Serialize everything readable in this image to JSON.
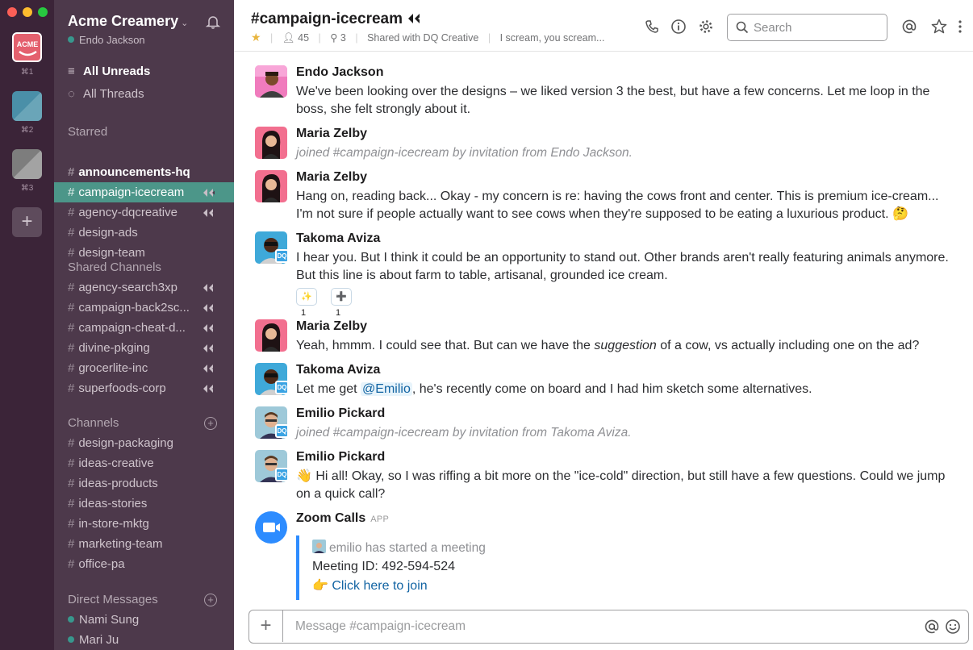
{
  "workspace": {
    "name": "Acme Creamery",
    "user": "Endo Jackson",
    "tiles": [
      {
        "label": "ACME",
        "shortcut": "⌘1",
        "color": "#e4606e"
      },
      {
        "label": "",
        "shortcut": "⌘2",
        "color": "#4a8fa8"
      },
      {
        "label": "",
        "shortcut": "⌘3",
        "color": "#888888"
      }
    ]
  },
  "sidebar": {
    "all_unreads": "All Unreads",
    "all_threads": "All Threads",
    "starred_heading": "Starred",
    "starred": [
      {
        "name": "announcements-hq",
        "bold": true,
        "shared": false,
        "active": false
      },
      {
        "name": "campaign-icecream",
        "bold": false,
        "shared": true,
        "active": true
      },
      {
        "name": "agency-dqcreative",
        "bold": false,
        "shared": true,
        "active": false
      },
      {
        "name": "design-ads",
        "bold": false,
        "shared": false,
        "active": false
      },
      {
        "name": "design-team",
        "bold": false,
        "shared": false,
        "active": false
      }
    ],
    "shared_heading": "Shared Channels",
    "shared_channels": [
      {
        "name": "agency-search3xp"
      },
      {
        "name": "campaign-back2sc..."
      },
      {
        "name": "campaign-cheat-d..."
      },
      {
        "name": "divine-pkging"
      },
      {
        "name": "grocerlite-inc"
      },
      {
        "name": "superfoods-corp"
      }
    ],
    "channels_heading": "Channels",
    "channels": [
      {
        "name": "design-packaging"
      },
      {
        "name": "ideas-creative"
      },
      {
        "name": "ideas-products"
      },
      {
        "name": "ideas-stories"
      },
      {
        "name": "in-store-mktg"
      },
      {
        "name": "marketing-team"
      },
      {
        "name": "office-pa"
      }
    ],
    "dm_heading": "Direct Messages",
    "direct_messages": [
      {
        "name": "Nami Sung"
      },
      {
        "name": "Mari Ju"
      }
    ]
  },
  "header": {
    "channel": "#campaign-icecream",
    "members": "45",
    "pinned": "3",
    "shared_with": "Shared with DQ Creative",
    "topic": "I scream, you scream..."
  },
  "search": {
    "placeholder": "Search"
  },
  "messages": [
    {
      "author": "Endo Jackson",
      "text": "We've been looking over the designs – we liked version 3 the best, but have a few concerns. Let me loop in the boss, she felt strongly about it."
    },
    {
      "author": "Maria Zelby",
      "text": "joined #campaign-icecream by invitation from Endo Jackson."
    },
    {
      "author": "Maria Zelby",
      "text": "Hang on, reading back... Okay - my concern is re: having the cows front and center. This is premium ice-cream... I'm not sure if people actually want to see cows when they're supposed to be eating a luxurious product.",
      "emoji": "🤔"
    },
    {
      "author": "Takoma Aviza",
      "badge": "DQ",
      "text": "I hear you. But I think it could be an opportunity to stand out. Other brands aren't really featuring animals anymore. But this line is about farm to table, artisanal, grounded ice cream.",
      "reactions": [
        {
          "emoji": "✨",
          "count": "1"
        },
        {
          "emoji": "➕",
          "count": "1"
        }
      ]
    },
    {
      "author": "Maria Zelby",
      "text_before": "Yeah, hmmm. I could see that. But can we have the ",
      "text_em": "suggestion",
      "text_after": " of a cow, vs actually including one on the ad?"
    },
    {
      "author": "Takoma Aviza",
      "badge": "DQ",
      "text_before": "Let me get ",
      "mention": "@Emilio",
      "text_after": ", he's recently come on board and I had him sketch some alternatives."
    },
    {
      "author": "Emilio Pickard",
      "badge": "DQ",
      "text": "joined #campaign-icecream by invitation from Takoma Aviza."
    },
    {
      "author": "Emilio Pickard",
      "badge": "DQ",
      "emoji": "👋",
      "text": "Hi all! Okay, so I was riffing a bit more on the \"ice-cold\" direction, but still have a few questions. Could we jump on a quick call?"
    },
    {
      "author": "Zoom Calls",
      "app_tag": "APP",
      "started": "emilio has started a meeting",
      "meeting_id": "Meeting ID: 492-594-524",
      "join_emoji": "👉",
      "join_link": "Click here to join"
    }
  ],
  "composer": {
    "placeholder": "Message #campaign-icecream"
  },
  "colors": {
    "sidebar": "#4d394b",
    "rail": "#3b2438",
    "active_channel": "#4c9689",
    "link": "#1264a3",
    "zoom": "#2d8cff"
  }
}
